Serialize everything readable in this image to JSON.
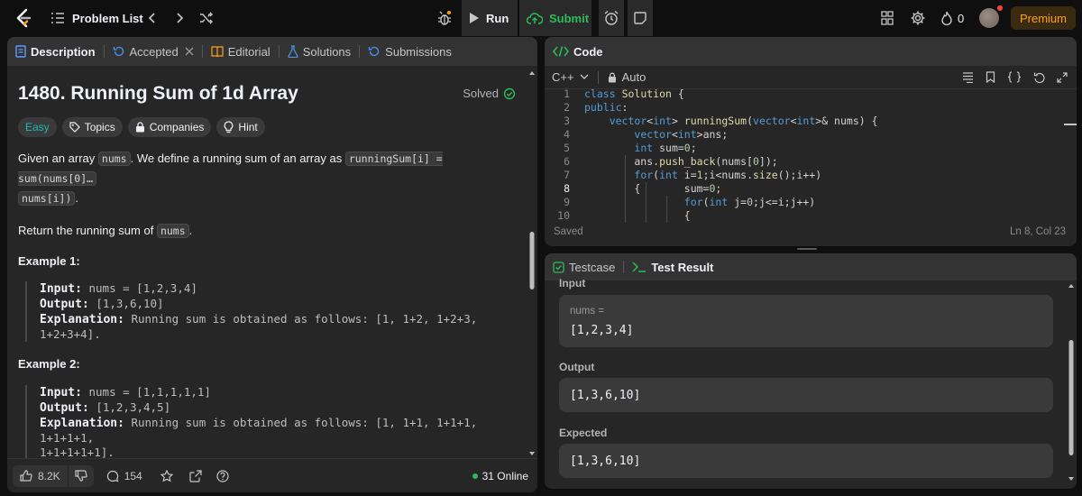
{
  "topbar": {
    "problem_list": "Problem List",
    "run": "Run",
    "submit": "Submit",
    "streak": "0",
    "premium": "Premium",
    "colors": {
      "submit": "#2cbb5d",
      "premium": "#ffa116",
      "premium_bg": "#3a2a12"
    }
  },
  "left": {
    "tabs": [
      "Description",
      "Accepted",
      "Editorial",
      "Solutions",
      "Submissions"
    ],
    "title": "1480. Running Sum of 1d Array",
    "solved": "Solved",
    "tags": {
      "difficulty": "Easy",
      "topics": "Topics",
      "companies": "Companies",
      "hint": "Hint"
    },
    "desc": {
      "p1a": "Given an array",
      "nums": "nums",
      "p1b": ". We define a running sum of an array as",
      "formula": "runningSum[i] = sum(nums[0]…",
      "formula2": "nums[i])",
      "p1c": ".",
      "p2a": "Return the running sum of",
      "p2b": "."
    },
    "examples": [
      {
        "heading": "Example 1:",
        "input_label": "Input:",
        "input": "nums = [1,2,3,4]",
        "output_label": "Output:",
        "output": "[1,3,6,10]",
        "expl_label": "Explanation:",
        "expl1": "Running sum is obtained as follows: [1, 1+2, 1+2+3,",
        "expl2": "1+2+3+4]."
      },
      {
        "heading": "Example 2:",
        "input_label": "Input:",
        "input": "nums = [1,1,1,1,1]",
        "output_label": "Output:",
        "output": "[1,2,3,4,5]",
        "expl_label": "Explanation:",
        "expl1": "Running sum is obtained as follows: [1, 1+1, 1+1+1, 1+1+1+1,",
        "expl2": "1+1+1+1+1]."
      }
    ],
    "footer": {
      "likes": "8.2K",
      "comments": "154",
      "online": "31 Online"
    }
  },
  "code": {
    "tab": "Code",
    "language": "C++",
    "mode": "Auto",
    "lines": [
      {
        "n": "1",
        "text": "class Solution {"
      },
      {
        "n": "2",
        "text": "public:"
      },
      {
        "n": "3",
        "text": "    vector<int> runningSum(vector<int>& nums) {"
      },
      {
        "n": "4",
        "text": "        vector<int>ans;"
      },
      {
        "n": "5",
        "text": "        int sum=0;"
      },
      {
        "n": "6",
        "text": "        ans.push_back(nums[0]);"
      },
      {
        "n": "7",
        "text": "        for(int i=1;i<nums.size();i++)"
      },
      {
        "n": "8",
        "text": "        {       sum=0;"
      },
      {
        "n": "9",
        "text": "                for(int j=0;j<=i;j++)"
      },
      {
        "n": "10",
        "text": "                {"
      }
    ],
    "saved": "Saved",
    "cursor": "Ln 8, Col 23"
  },
  "test": {
    "tabs": [
      "Testcase",
      "Test Result"
    ],
    "input_label": "Input",
    "var_name": "nums =",
    "var_value": "[1,2,3,4]",
    "output_label": "Output",
    "output_value": "[1,3,6,10]",
    "expected_label": "Expected",
    "expected_value": "[1,3,6,10]"
  }
}
